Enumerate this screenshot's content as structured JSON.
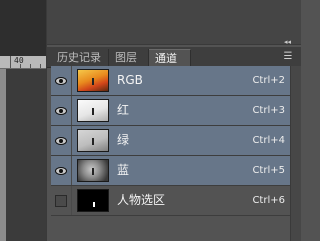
{
  "ruler": {
    "label": "40"
  },
  "panel": {
    "tabs": [
      {
        "label": "历史记录"
      },
      {
        "label": "图层"
      },
      {
        "label": "通道"
      }
    ],
    "channels": [
      {
        "name": "RGB",
        "shortcut": "Ctrl+2",
        "visible": true,
        "selected": true,
        "thumb": "color"
      },
      {
        "name": "红",
        "shortcut": "Ctrl+3",
        "visible": true,
        "selected": true,
        "thumb": "gray"
      },
      {
        "name": "绿",
        "shortcut": "Ctrl+4",
        "visible": true,
        "selected": true,
        "thumb": "gray"
      },
      {
        "name": "蓝",
        "shortcut": "Ctrl+5",
        "visible": true,
        "selected": true,
        "thumb": "gray"
      },
      {
        "name": "人物选区",
        "shortcut": "Ctrl+6",
        "visible": false,
        "selected": false,
        "thumb": "mask"
      }
    ],
    "colors": {
      "selected_row": "#677689",
      "panel_bg": "#535353"
    }
  }
}
